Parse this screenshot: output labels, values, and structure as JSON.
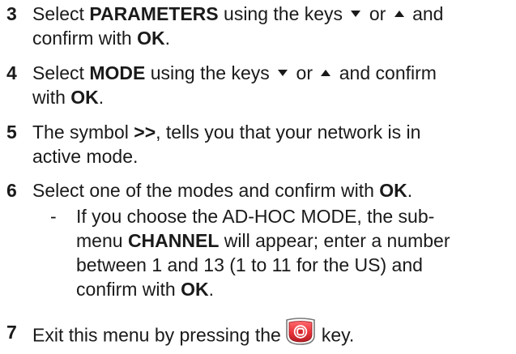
{
  "steps": [
    {
      "number": "3",
      "line1_pre": "Select ",
      "line1_bold": "PARAMETERS",
      "line1_post": " using the keys ",
      "or": " or ",
      "line1_end": " and",
      "line2_pre": "confirm with ",
      "line2_bold": "OK",
      "line2_end": "."
    },
    {
      "number": "4",
      "line1_pre": "Select ",
      "line1_bold": "MODE",
      "line1_post": " using the keys ",
      "or": " or ",
      "line1_end": " and confirm",
      "line2_pre": "with ",
      "line2_bold": "OK",
      "line2_end": "."
    },
    {
      "number": "5",
      "line1_pre": "The symbol ",
      "line1_bold": ">>",
      "line1_post": ", tells you that your network is in",
      "line2_pre": "active mode."
    },
    {
      "number": "6",
      "line1_pre": "Select one of the modes and confirm with ",
      "line1_bold": "OK",
      "line1_end": "."
    },
    {
      "number": "7",
      "line1_pre": "Exit this menu by pressing the",
      "line1_end": "key."
    }
  ],
  "substep": {
    "dash": "-",
    "line1": "If you choose the AD-HOC MODE, the sub-",
    "line2_pre": "menu ",
    "line2_bold": "CHANNEL",
    "line2_post": " will appear; enter a number",
    "line3": "between 1 and 13 (1 to 11 for the US) and",
    "line4_pre": "confirm with ",
    "line4_bold": "OK",
    "line4_end": "."
  },
  "icons": {
    "down_arrow": "down-triangle-icon",
    "up_arrow": "up-triangle-icon",
    "stop_key": "stop-key-icon"
  },
  "colors": {
    "text": "#1a1a1a",
    "stop_key_red": "#e8333a"
  }
}
